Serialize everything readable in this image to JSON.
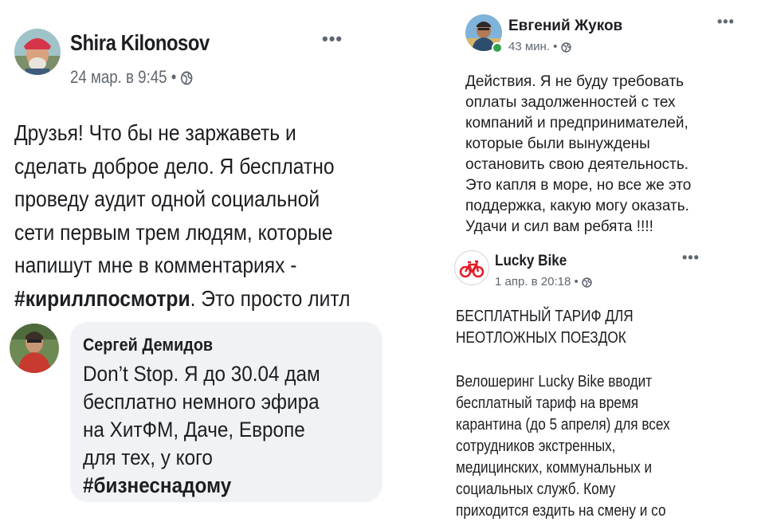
{
  "post_left": {
    "author": "Shira Kilonosov",
    "meta": "24 мар. в 9:45 •",
    "body_lines": [
      "Друзья! Что бы не заржаветь и",
      "сделать доброе дело. Я бесплатно",
      "проведу аудит одной социальной",
      "сети первым трем людям, которые",
      "напишут мне в комментариях -"
    ],
    "last_line_hashtag": "#кириллпосмотри",
    "last_line_rest": ". Это просто литл",
    "comment": {
      "author": "Сергей Демидов",
      "body_lines": [
        "Don’t Stop. Я до 30.04 дам",
        "бесплатно немного эфира",
        "на ХитФМ, Даче, Европе",
        "для тех, у кого"
      ],
      "hashtag": "#бизнеснадому"
    }
  },
  "post_right_top": {
    "author": "Евгений Жуков",
    "meta": "43 мин. •",
    "body_lines": [
      "Действия. Я не буду требовать",
      "оплаты задолженностей с тех",
      "компаний и предпринимателей,",
      "которые были вынуждены",
      "остановить свою деятельность.",
      "Это капля в море, но все же это",
      "поддержка, какую могу оказать.",
      "Удачи и сил вам ребята !!!!"
    ]
  },
  "post_right_bottom": {
    "author": "Lucky Bike",
    "meta": "1 апр. в 20:18 •",
    "title_lines": [
      "БЕСПЛАТНЫЙ ТАРИФ ДЛЯ",
      "НЕОТЛОЖНЫХ ПОЕЗДОК"
    ],
    "body_lines": [
      "Велошеринг Lucky Bike вводит",
      "бесплатный тариф на время",
      "карантина (до 5 апреля) для всех",
      "сотрудников экстренных,",
      "медицинских, коммунальных и",
      "социальных служб. Кому",
      "приходится ездить на смену и со"
    ]
  },
  "icons": {
    "more": "more-options-icon",
    "globe": "globe-icon",
    "bike_logo": "bicycle-icon"
  },
  "colors": {
    "meta_text": "#606770",
    "bubble_bg": "#f0f2f5",
    "online_dot": "#31a24c",
    "bike_logo": "#e41e26"
  }
}
